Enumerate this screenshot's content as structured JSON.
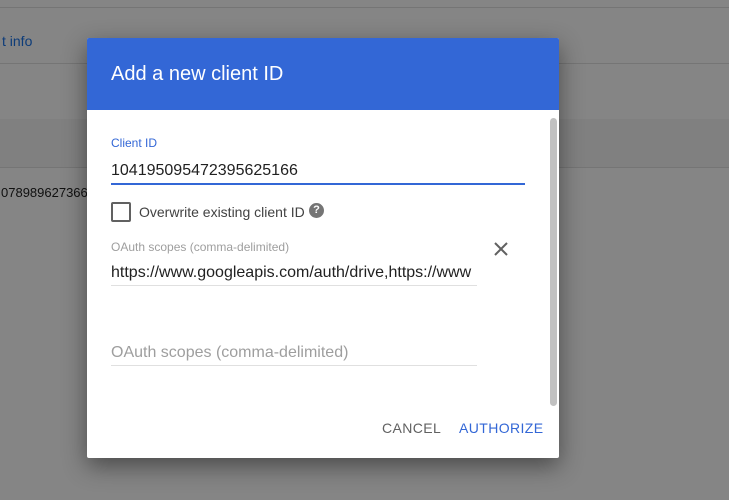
{
  "background": {
    "link_text": "t info",
    "row_value": "078989627366"
  },
  "dialog": {
    "title": "Add a new client ID",
    "client_id": {
      "label": "Client ID",
      "value": "104195095472395625166"
    },
    "overwrite": {
      "label": "Overwrite existing client ID",
      "checked": false,
      "help_icon": "help-icon"
    },
    "scopes": {
      "label": "OAuth scopes (comma-delimited)",
      "value": "https://www.googleapis.com/auth/drive,https://www",
      "remove_icon": "close-icon",
      "new_placeholder": "OAuth scopes (comma-delimited)"
    },
    "buttons": {
      "cancel": "CANCEL",
      "authorize": "AUTHORIZE"
    }
  },
  "colors": {
    "header": "#3367d6",
    "accent": "#3367d6",
    "scrim": "rgba(0,0,0,0.48)"
  }
}
